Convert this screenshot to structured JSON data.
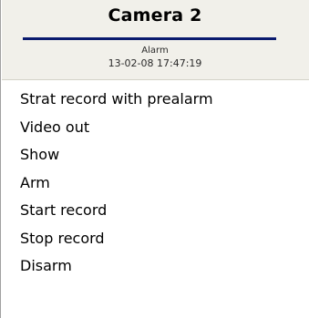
{
  "header": {
    "camera_title": "Camera 2",
    "status_text": "Alarm",
    "timestamp": "13-02-08 17:47:19"
  },
  "menu": {
    "items": [
      {
        "label": "Strat record with prealarm"
      },
      {
        "label": "Video out"
      },
      {
        "label": "Show"
      },
      {
        "label": "Arm"
      },
      {
        "label": "Start record"
      },
      {
        "label": "Stop record"
      },
      {
        "label": "Disarm"
      }
    ]
  },
  "colors": {
    "header_background": "#f1f0ea",
    "title_underline": "#0a1a6e"
  }
}
